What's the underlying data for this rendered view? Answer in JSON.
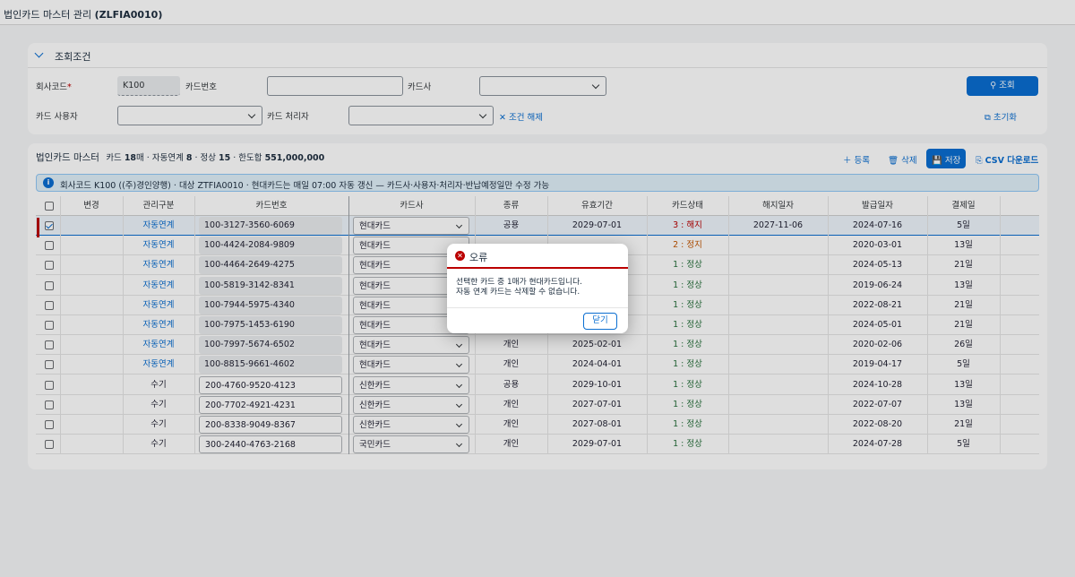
{
  "app": {
    "title": "법인카드 마스터 관리",
    "code": "(ZLFIA0010)"
  },
  "search": {
    "section_title": "조회조건",
    "company_label": "회사코드",
    "company_value": "K100",
    "card_no_label": "카드번호",
    "card_co_label": "카드사",
    "card_user_label": "카드 사용자",
    "card_handler_label": "카드 처리자",
    "clear_label": "조건 해제",
    "search_label": "조회",
    "reset_label": "초기화"
  },
  "table": {
    "title": "법인카드 마스터",
    "summary": {
      "t1": "카드 ",
      "cards": "18",
      "t2": "매 · 자동연계 ",
      "auto": "8",
      "t3": " · 정상 ",
      "normal": "15",
      "t4": " · 한도합 ",
      "limit": "551,000,000"
    },
    "toolbar": {
      "add": "등록",
      "delete": "삭제",
      "save": "저장",
      "csv": "CSV 다운로드"
    },
    "info": "회사코드 K100 ((주)경인양행) · 대상 ZTFIA0010 · 현대카드는 매일 07:00 자동 갱신 — 카드사·사용자·처리자·반납예정일만 수정 가능",
    "headers": [
      "변경",
      "관리구분",
      "카드번호",
      "카드사",
      "종류",
      "유효기간",
      "카드상태",
      "해지일자",
      "발급일자",
      "결제일"
    ],
    "rows": [
      {
        "checked": true,
        "mgmt": "자동연계",
        "card": "100-3127-3560-6069",
        "company": "현대카드",
        "kind": "공용",
        "valid": "2029-07-01",
        "status": "3 : 해지",
        "status_type": "bad",
        "term": "2027-11-06",
        "issued": "2024-07-16",
        "pay": "5일"
      },
      {
        "checked": false,
        "mgmt": "자동연계",
        "card": "100-4424-2084-9809",
        "company": "현대카드",
        "kind": "",
        "valid": "",
        "status": "2 : 정지",
        "status_type": "warn",
        "term": "",
        "issued": "2020-03-01",
        "pay": "13일"
      },
      {
        "checked": false,
        "mgmt": "자동연계",
        "card": "100-4464-2649-4275",
        "company": "현대카드",
        "kind": "",
        "valid": "",
        "status": "1 : 정상",
        "status_type": "ok",
        "term": "",
        "issued": "2024-05-13",
        "pay": "21일"
      },
      {
        "checked": false,
        "mgmt": "자동연계",
        "card": "100-5819-3142-8341",
        "company": "현대카드",
        "kind": "",
        "valid": "",
        "status": "1 : 정상",
        "status_type": "ok",
        "term": "",
        "issued": "2019-06-24",
        "pay": "13일"
      },
      {
        "checked": false,
        "mgmt": "자동연계",
        "card": "100-7944-5975-4340",
        "company": "현대카드",
        "kind": "",
        "valid": "",
        "status": "1 : 정상",
        "status_type": "ok",
        "term": "",
        "issued": "2022-08-21",
        "pay": "21일"
      },
      {
        "checked": false,
        "mgmt": "자동연계",
        "card": "100-7975-1453-6190",
        "company": "현대카드",
        "kind": "",
        "valid": "",
        "status": "1 : 정상",
        "status_type": "ok",
        "term": "",
        "issued": "2024-05-01",
        "pay": "21일"
      },
      {
        "checked": false,
        "mgmt": "자동연계",
        "card": "100-7997-5674-6502",
        "company": "현대카드",
        "kind": "개인",
        "valid": "2025-02-01",
        "status": "1 : 정상",
        "status_type": "ok",
        "term": "",
        "issued": "2020-02-06",
        "pay": "26일"
      },
      {
        "checked": false,
        "mgmt": "자동연계",
        "card": "100-8815-9661-4602",
        "company": "현대카드",
        "kind": "개인",
        "valid": "2024-04-01",
        "status": "1 : 정상",
        "status_type": "ok",
        "term": "",
        "issued": "2019-04-17",
        "pay": "5일"
      },
      {
        "checked": false,
        "mgmt": "수기",
        "card": "200-4760-9520-4123",
        "company": "신한카드",
        "kind": "공용",
        "valid": "2029-10-01",
        "status": "1 : 정상",
        "status_type": "ok",
        "term": "",
        "issued": "2024-10-28",
        "pay": "13일"
      },
      {
        "checked": false,
        "mgmt": "수기",
        "card": "200-7702-4921-4231",
        "company": "신한카드",
        "kind": "개인",
        "valid": "2027-07-01",
        "status": "1 : 정상",
        "status_type": "ok",
        "term": "",
        "issued": "2022-07-07",
        "pay": "13일"
      },
      {
        "checked": false,
        "mgmt": "수기",
        "card": "200-8338-9049-8367",
        "company": "신한카드",
        "kind": "개인",
        "valid": "2027-08-01",
        "status": "1 : 정상",
        "status_type": "ok",
        "term": "",
        "issued": "2022-08-20",
        "pay": "21일"
      },
      {
        "checked": false,
        "mgmt": "수기",
        "card": "300-2440-4763-2168",
        "company": "국민카드",
        "kind": "개인",
        "valid": "2029-07-01",
        "status": "1 : 정상",
        "status_type": "ok",
        "term": "",
        "issued": "2024-07-28",
        "pay": "5일"
      }
    ]
  },
  "dialog": {
    "title": "오류",
    "line1": "선택한 카드 중 1매가 현대카드입니다.",
    "line2": "자동 연계 카드는 삭제할 수 없습니다.",
    "close": "닫기"
  },
  "colors": {
    "accent": "#0a6ed1",
    "error": "#bb0000",
    "ok": "#256f3a",
    "warn": "#c35500"
  }
}
